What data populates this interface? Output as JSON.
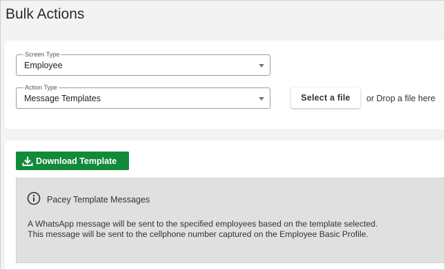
{
  "page": {
    "title": "Bulk Actions"
  },
  "form": {
    "screen_type": {
      "label": "Screen Type",
      "value": "Employee"
    },
    "action_type": {
      "label": "Action Type",
      "value": "Message Templates"
    },
    "file": {
      "button_label": "Select a file",
      "drop_text": "or Drop a file here"
    }
  },
  "download": {
    "label": "Download Template",
    "icon": "download-icon",
    "color": "#128a3a"
  },
  "info": {
    "icon": "info-icon",
    "title": "Pacey Template Messages",
    "lines": [
      "A WhatsApp message will be sent to the specified employees based on the template selected.",
      "This message will be sent to the cellphone number captured on the Employee Basic Profile."
    ]
  }
}
